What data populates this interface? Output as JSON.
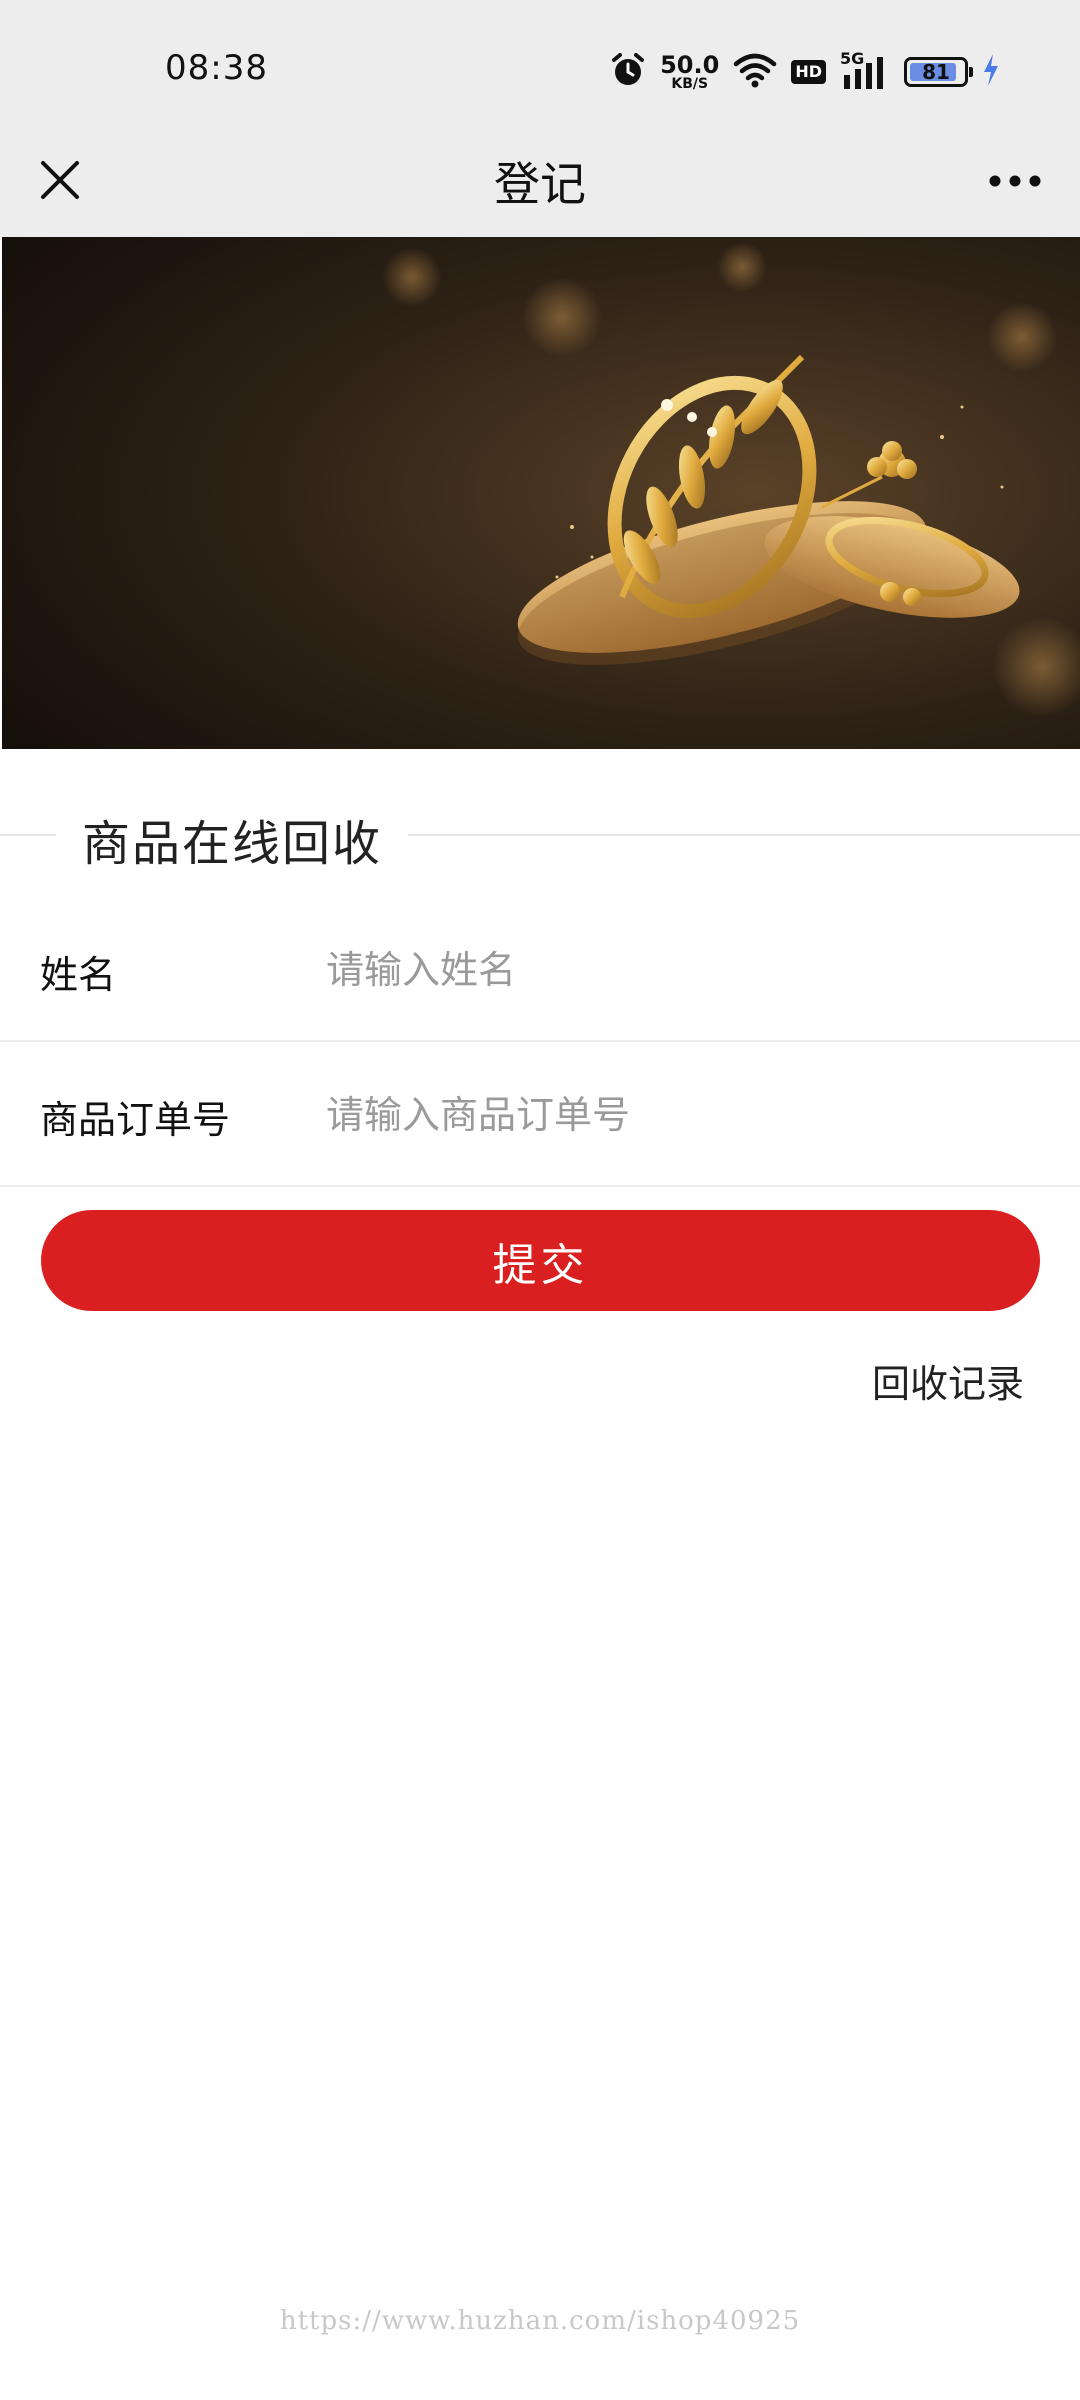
{
  "status_bar": {
    "time": "08:38",
    "net_speed_value": "50.0",
    "net_speed_unit": "KB/S",
    "hd_badge": "HD",
    "signal_label": "5G",
    "battery_level": "81",
    "icons": [
      "alarm-icon",
      "wifi-icon",
      "signal-icon",
      "battery-icon",
      "charging-icon"
    ]
  },
  "nav": {
    "title": "登记",
    "close_icon": "close-icon",
    "more_icon": "more-icon"
  },
  "banner": {
    "icon": "gold-jewelry-banner-image"
  },
  "section": {
    "title": "商品在线回收"
  },
  "form": {
    "name_label": "姓名",
    "name_placeholder": "请输入姓名",
    "name_value": "",
    "order_label": "商品订单号",
    "order_placeholder": "请输入商品订单号",
    "order_value": ""
  },
  "submit_label": "提交",
  "history_link": "回收记录",
  "watermark": "https://www.huzhan.com/ishop40925",
  "colors": {
    "accent": "#d91f1f",
    "nav_bg": "#ededed",
    "battery_fill": "#6b8de3",
    "charging": "#4a7be8"
  }
}
